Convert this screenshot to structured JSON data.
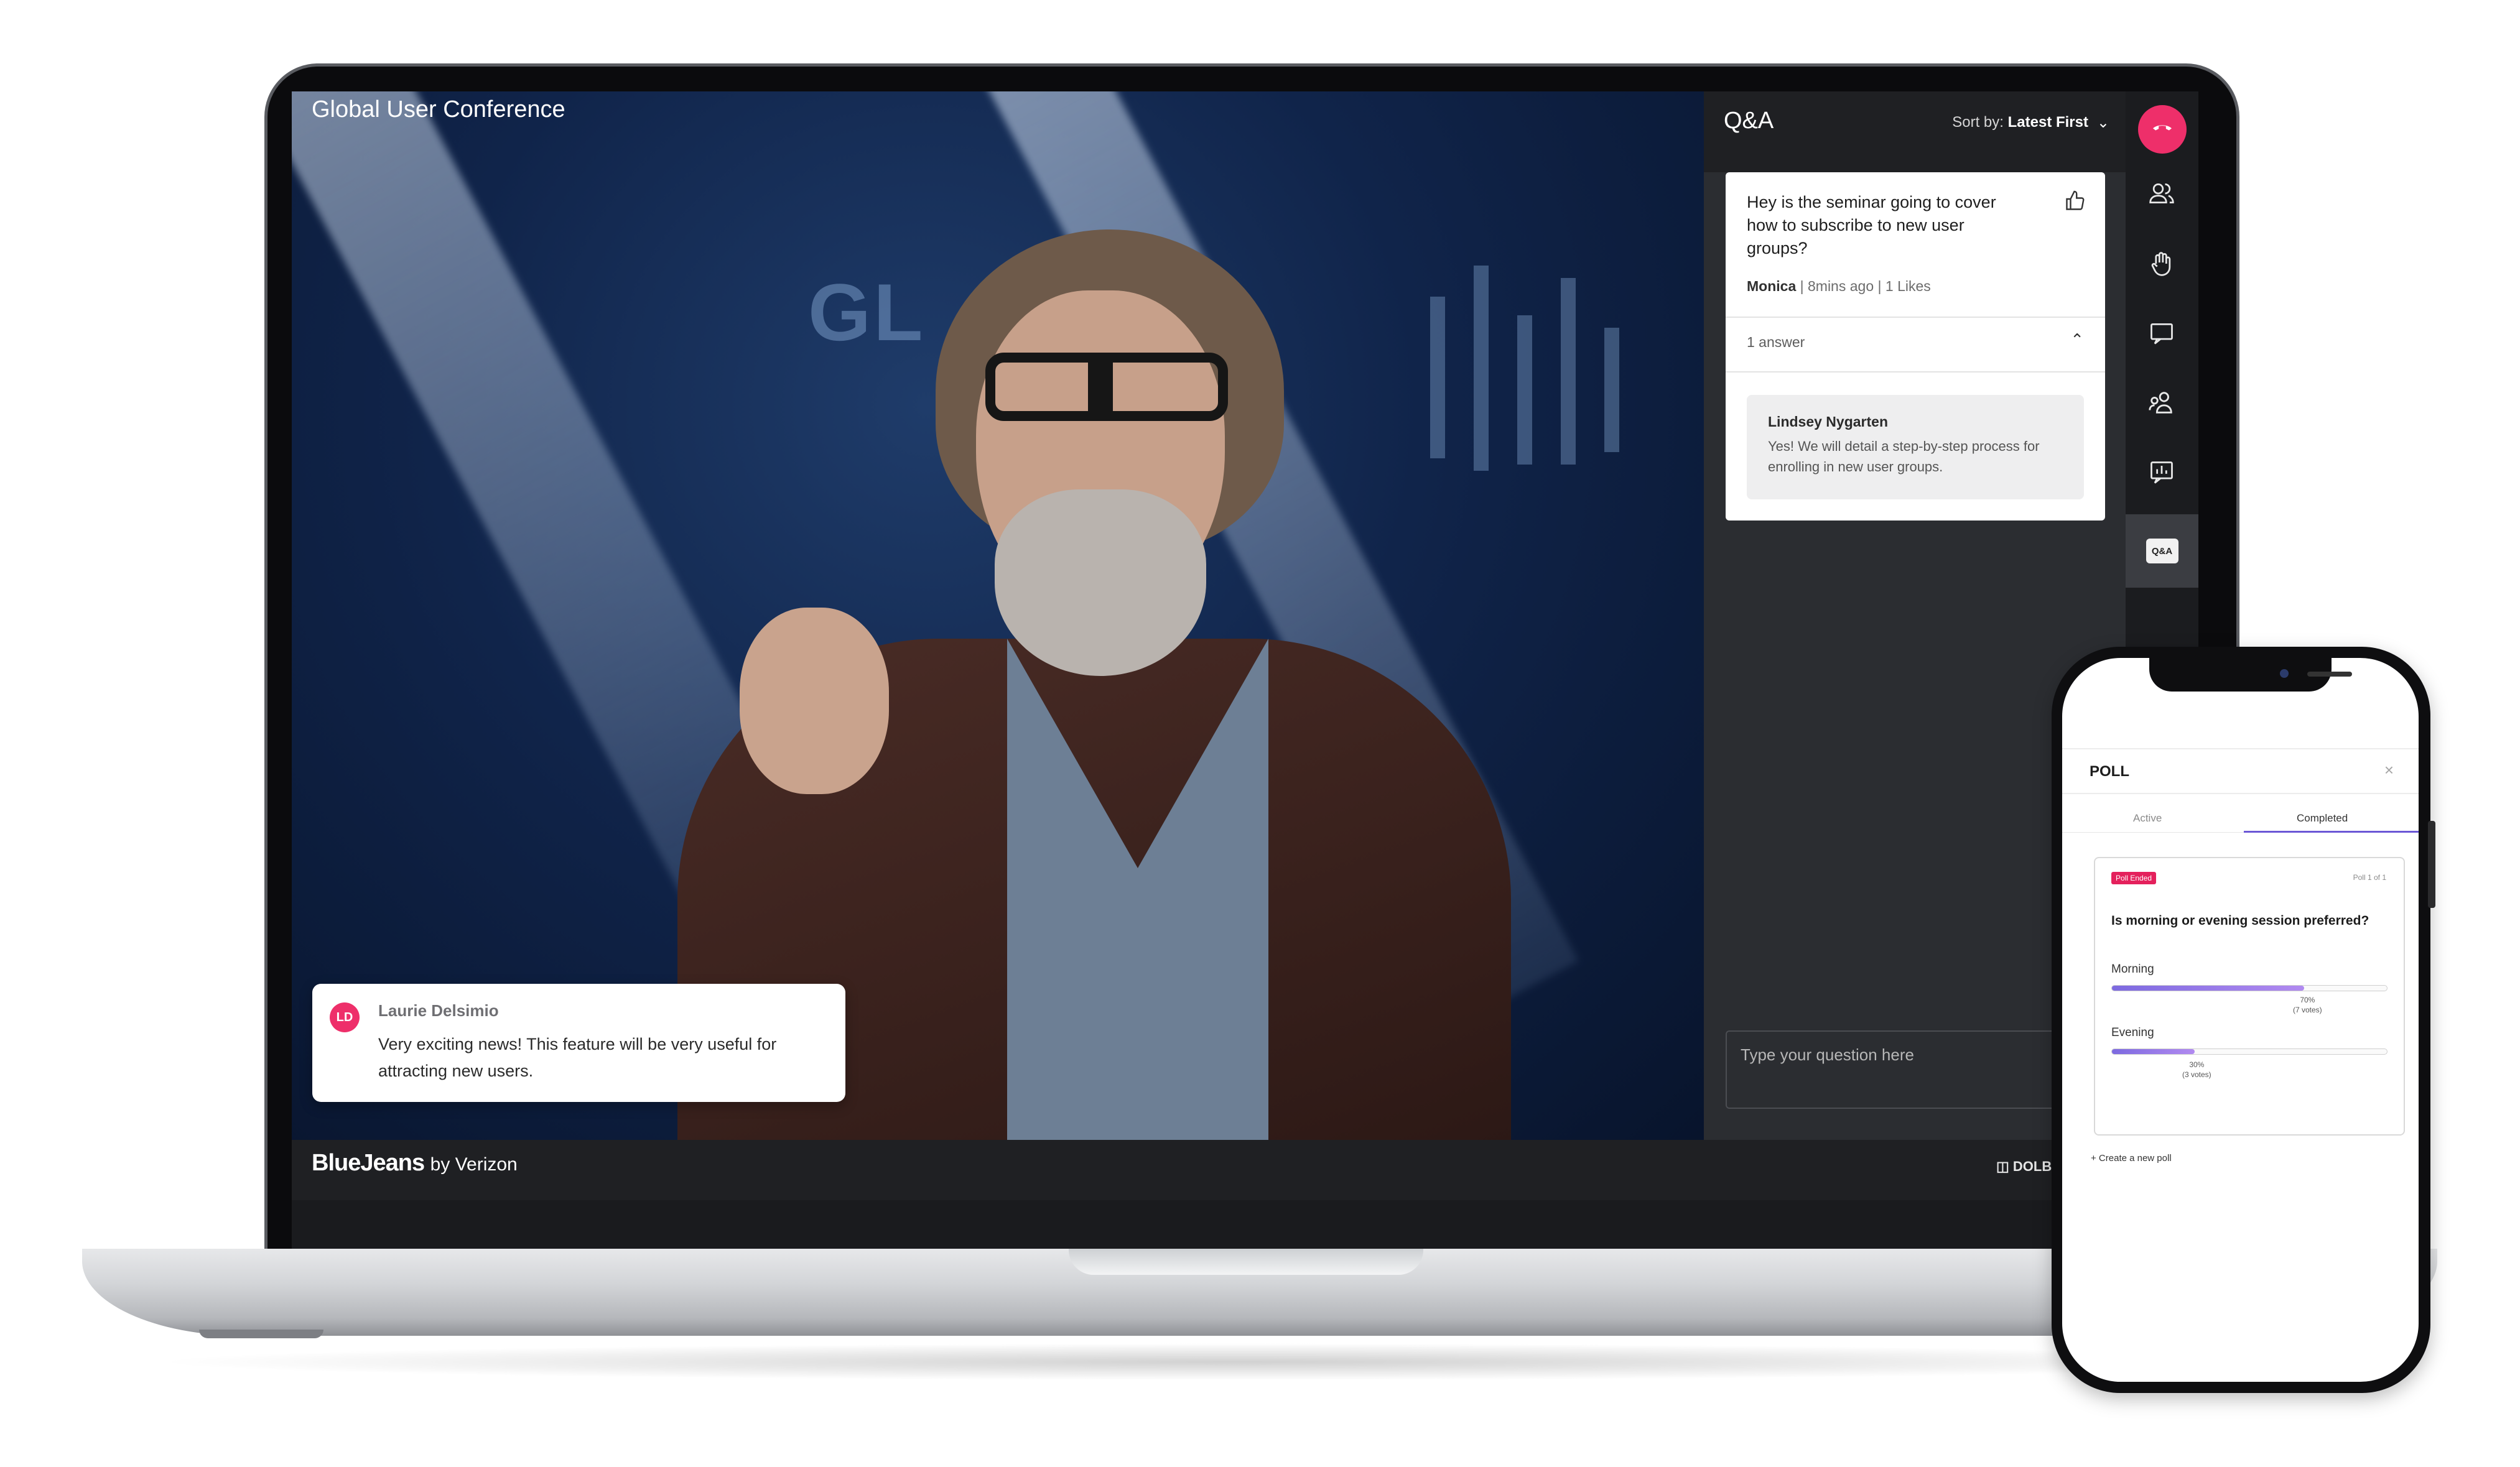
{
  "stream": {
    "title": "Global User Conference",
    "backdrop_letters": "GL"
  },
  "chat_toast": {
    "initials": "LD",
    "name": "Laurie Delsimio",
    "message": "Very exciting news! This feature will be very useful for attracting new users."
  },
  "footer": {
    "brand": "BlueJeans",
    "brand_sub": "by Verizon",
    "dolby": "DOLB"
  },
  "qa": {
    "title": "Q&A",
    "sort_label": "Sort by:",
    "sort_value": "Latest First",
    "question": {
      "text": "Hey is the seminar going to cover how to subscribe to new user groups?",
      "author": "Monica",
      "time": "8mins ago",
      "likes": "1 Likes",
      "answers_count": "1 answer"
    },
    "answer": {
      "author": "Lindsey Nygarten",
      "text": "Yes! We will detail a step-by-step process for enrolling in new user groups."
    },
    "input_placeholder": "Type your question here"
  },
  "toolbar": {
    "items": [
      "end-call",
      "participants",
      "raise-hand",
      "chat",
      "breakout",
      "polls",
      "qa"
    ],
    "qa_chip": "Q&A"
  },
  "phone": {
    "poll_title": "POLL",
    "tabs": [
      "Active",
      "Completed"
    ],
    "active_tab": "Completed",
    "badge": "Poll Ended",
    "poll_count": "Poll 1 of 1",
    "question": "Is morning or evening session preferred?",
    "options": [
      {
        "label": "Morning",
        "percent": "70%",
        "votes": "(7 votes)",
        "value": 0.7
      },
      {
        "label": "Evening",
        "percent": "30%",
        "votes": "(3 votes)",
        "value": 0.3
      }
    ],
    "create_link": "+ Create a new poll"
  },
  "colors": {
    "accent": "#ee2f6a",
    "poll_bar": "#7d6ae0",
    "panel_bg": "#2b2d31"
  }
}
